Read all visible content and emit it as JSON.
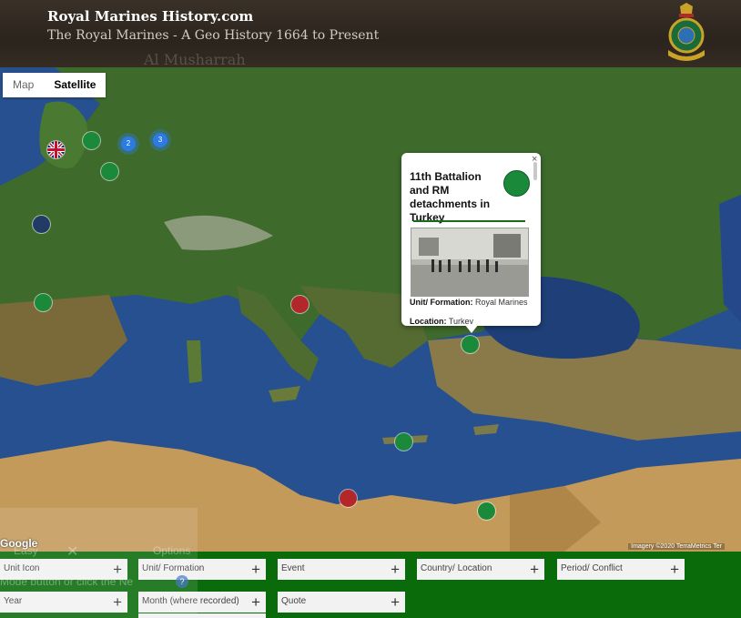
{
  "header": {
    "title": "Royal Marines History.com",
    "subtitle": "The Royal Marines - A Geo History 1664 to Present",
    "ghost_label": "Al Musharrah"
  },
  "map_type": {
    "map": "Map",
    "satellite": "Satellite",
    "selected": "Satellite"
  },
  "markers": [
    {
      "kind": "uk-flag",
      "label": ""
    },
    {
      "kind": "green",
      "label": ""
    },
    {
      "kind": "green",
      "label": ""
    },
    {
      "kind": "navy",
      "label": ""
    },
    {
      "kind": "green",
      "label": ""
    },
    {
      "kind": "red",
      "label": ""
    },
    {
      "kind": "green",
      "label": ""
    },
    {
      "kind": "green",
      "label": ""
    },
    {
      "kind": "red",
      "label": ""
    },
    {
      "kind": "green",
      "label": ""
    }
  ],
  "clusters": [
    {
      "count": "2"
    },
    {
      "count": "3"
    }
  ],
  "popup": {
    "title": "11th Battalion and RM detachments in Turkey",
    "close": "×",
    "fields": [
      {
        "label": "Unit/ Formation:",
        "value": "Royal Marines"
      },
      {
        "label": "Location:",
        "value": "Turkey"
      }
    ]
  },
  "attribution": "Imagery ©2020 TerraMetrics",
  "attribution_extra": "Ter",
  "google_logo": "Google",
  "filters": {
    "unit_icon": "Unit Icon",
    "unit_formation": "Unit/ Formation",
    "event": "Event",
    "country_location": "Country/ Location",
    "period_conflict": "Period/ Conflict",
    "year": "Year",
    "month": "Month (where recorded)",
    "quote": "Quote",
    "plus": "+"
  },
  "ghost_overlay": {
    "easy": "Easy",
    "close": "✕",
    "options": "Options",
    "hint": "Mode button or click the Ne",
    "help": "?"
  },
  "colors": {
    "header_bg": "#2b241d",
    "panel_green": "#0a6b0a",
    "marker_green": "#1a8a3a",
    "marker_red": "#b3262a",
    "cluster_blue": "#2c7be5"
  }
}
